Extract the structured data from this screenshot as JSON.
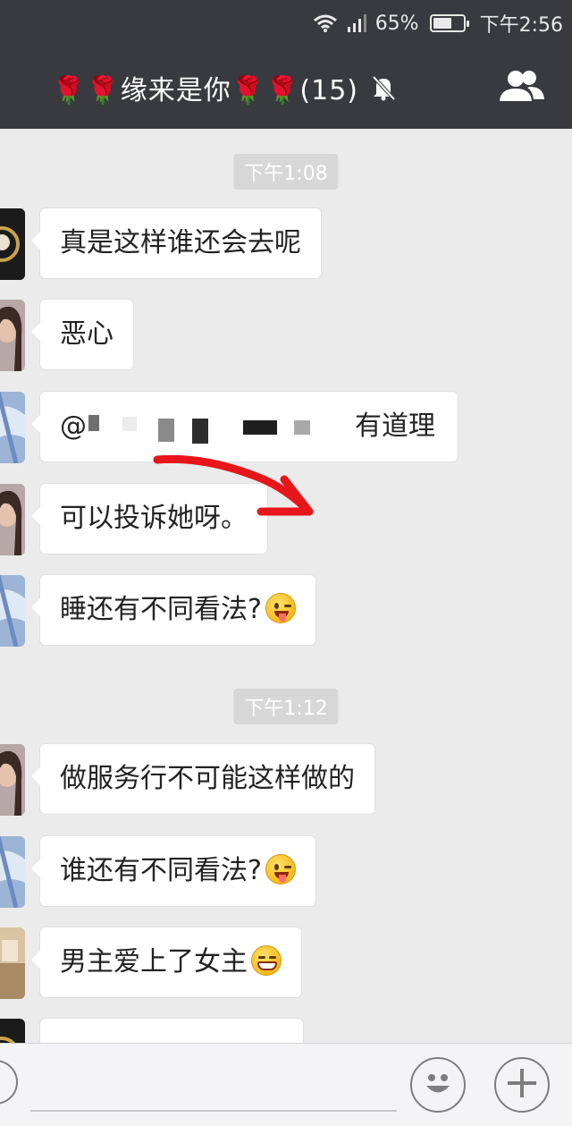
{
  "status_bar": {
    "battery_percent": "65%",
    "battery_level": 0.65,
    "time": "下午2:56",
    "wifi_icon": "wifi-icon",
    "signal_icon": "signal-icon"
  },
  "header": {
    "title": "🌹🌹缘来是你🌹🌹(15)",
    "mute_icon": "bell-off-icon",
    "group_icon": "group-members-icon"
  },
  "chat": {
    "timestamps": [
      "下午1:08",
      "下午1:12"
    ],
    "messages": [
      {
        "text": "真是这样谁还会去呢"
      },
      {
        "text": "恶心"
      },
      {
        "prefix": "@",
        "suffix": "有道理"
      },
      {
        "text": "可以投诉她呀。"
      },
      {
        "text": "睡还有不同看法?"
      },
      {
        "text": "做服务行不可能这样做的"
      },
      {
        "text": "谁还有不同看法?"
      },
      {
        "text": "男主爱上了女主"
      }
    ]
  },
  "colors": {
    "header_bg": "#393a3f",
    "chat_bg": "#ebebeb",
    "bubble_bg": "#ffffff",
    "arrow_red": "#e8151b"
  },
  "input_bar": {
    "voice_icon": "voice-icon",
    "emoji_icon": "emoji-icon",
    "plus_icon": "plus-icon"
  }
}
